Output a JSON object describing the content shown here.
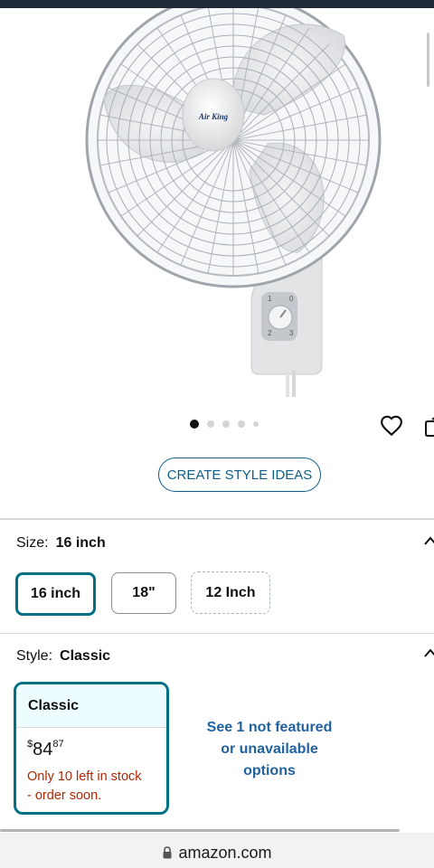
{
  "product": {
    "brand_logo": "Air King",
    "image_icon": "wall-fan-image",
    "dial_numbers": [
      "1",
      "0",
      "2",
      "3"
    ],
    "carousel": {
      "total_images": 5,
      "active_index": 0
    }
  },
  "actions": {
    "favorite_icon": "heart-icon",
    "share_icon": "share-icon",
    "create_style_ideas": "CREATE STYLE IDEAS"
  },
  "size": {
    "label": "Size:",
    "selected": "16 inch",
    "options": [
      "16 inch",
      "18\"",
      "12 Inch"
    ]
  },
  "style": {
    "label": "Style:",
    "selected": "Classic",
    "card": {
      "name": "Classic",
      "currency": "$",
      "price_whole": "84",
      "price_fraction": "87",
      "stock_line1": "Only 10 left in stock",
      "stock_line2": "- order soon."
    },
    "see_more_line1": "See 1 not featured",
    "see_more_line2": "or unavailable",
    "see_more_line3": "options"
  },
  "browser": {
    "url": "amazon.com"
  },
  "colors": {
    "accent": "#007185",
    "link": "#2162a1",
    "stock": "#b12704",
    "card_header": "#edfdff"
  }
}
